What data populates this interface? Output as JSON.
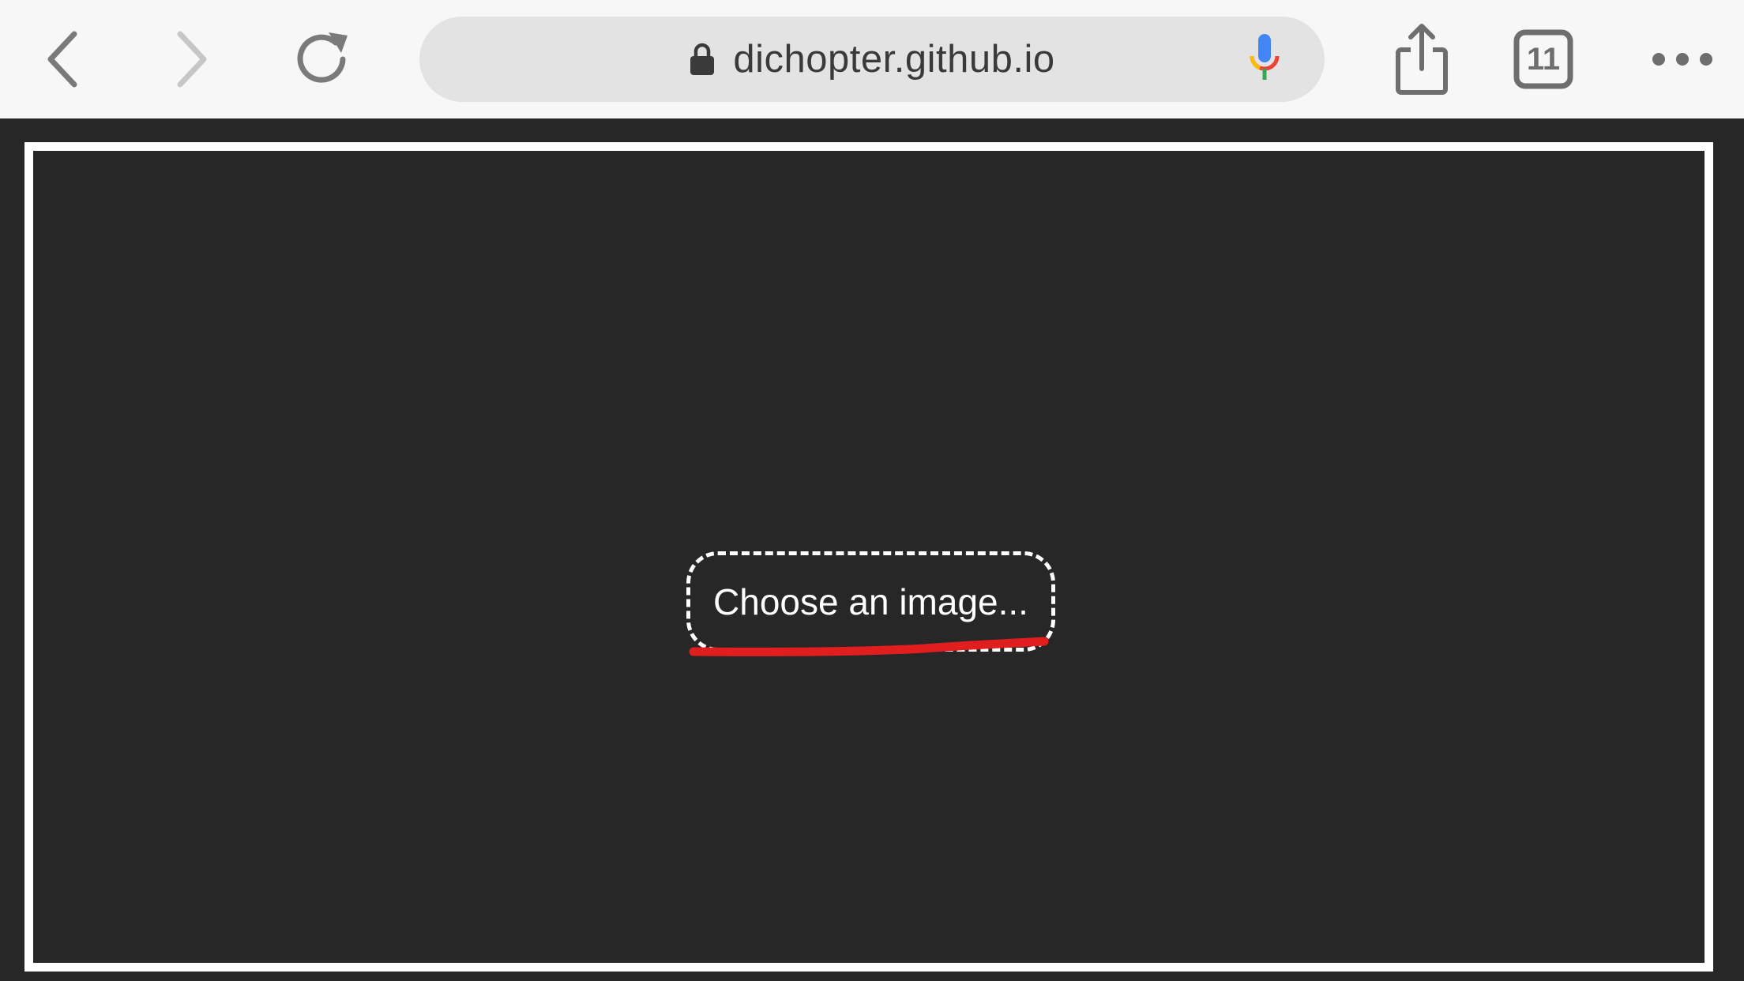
{
  "browser": {
    "url": "dichopter.github.io",
    "tab_count": "11"
  },
  "page": {
    "choose_label": "Choose an image..."
  },
  "colors": {
    "toolbar_bg": "#f7f7f7",
    "address_bar_bg": "#e3e3e3",
    "page_bg": "#272727",
    "frame_border": "#ffffff",
    "annotation_red": "#e01e1e"
  },
  "icons": {
    "back": "chevron-left-icon",
    "forward": "chevron-right-icon",
    "reload": "reload-icon",
    "lock": "lock-icon",
    "mic": "microphone-icon",
    "share": "share-icon",
    "tabs": "tabs-icon",
    "more": "more-icon"
  }
}
